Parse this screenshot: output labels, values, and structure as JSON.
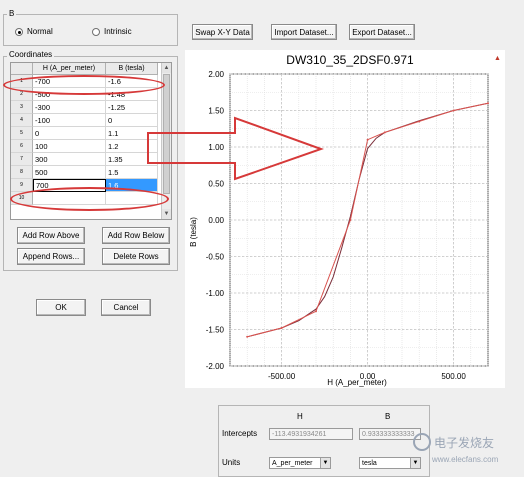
{
  "b_group": {
    "legend": "B",
    "radio_normal": "Normal",
    "radio_intrinsic": "Intrinsic",
    "selected": "Normal"
  },
  "toolbar": {
    "swap_xy": "Swap X-Y Data",
    "import_dataset": "Import Dataset...",
    "export_dataset": "Export Dataset..."
  },
  "coordinates": {
    "legend": "Coordinates",
    "columns": [
      "H (A_per_meter)",
      "B (tesla)"
    ],
    "rows": [
      {
        "n": "1",
        "h": "-700",
        "b": "-1.6"
      },
      {
        "n": "2",
        "h": "-500",
        "b": "-1.48"
      },
      {
        "n": "3",
        "h": "-300",
        "b": "-1.25"
      },
      {
        "n": "4",
        "h": "-100",
        "b": "0"
      },
      {
        "n": "5",
        "h": "0",
        "b": "1.1"
      },
      {
        "n": "6",
        "h": "100",
        "b": "1.2"
      },
      {
        "n": "7",
        "h": "300",
        "b": "1.35"
      },
      {
        "n": "8",
        "h": "500",
        "b": "1.5"
      },
      {
        "n": "9",
        "h": "700",
        "b": "1.6"
      },
      {
        "n": "10",
        "h": "",
        "b": ""
      }
    ]
  },
  "row_buttons": {
    "add_above": "Add Row Above",
    "add_below": "Add Row Below",
    "append": "Append Rows...",
    "delete": "Delete Rows"
  },
  "dialog": {
    "ok": "OK",
    "cancel": "Cancel"
  },
  "chart_data": {
    "type": "line",
    "title": "DW310_35_2DSF0.971",
    "xlabel": "H (A_per_meter)",
    "ylabel": "B (tesla)",
    "xlim": [
      -800,
      700
    ],
    "ylim": [
      -2.0,
      2.0
    ],
    "xticks": [
      -500,
      0,
      500
    ],
    "xtick_labels": [
      "-500.00",
      "0.00",
      "500.00"
    ],
    "yticks": [
      2.0,
      1.5,
      1.0,
      0.5,
      0.0,
      -0.5,
      -1.0,
      -1.5,
      -2.0
    ],
    "ytick_labels": [
      "2.00",
      "1.50",
      "1.00",
      "0.50",
      "0.00",
      "-0.50",
      "-1.00",
      "-1.50",
      "-2.00"
    ],
    "grid": true,
    "series": [
      {
        "x": [
          -700,
          -500,
          -300,
          -100,
          0,
          100,
          300,
          500,
          700
        ],
        "y": [
          -1.6,
          -1.48,
          -1.25,
          0,
          1.1,
          1.2,
          1.35,
          1.5,
          1.6
        ],
        "color": "#d9534f"
      }
    ],
    "fitted": {
      "x": [
        -700,
        -500,
        -400,
        -300,
        -250,
        -200,
        -150,
        -100,
        -50,
        0,
        50,
        100,
        200,
        300,
        500,
        700
      ],
      "y": [
        -1.6,
        -1.48,
        -1.38,
        -1.22,
        -1.05,
        -0.78,
        -0.38,
        0.05,
        0.55,
        0.98,
        1.12,
        1.2,
        1.28,
        1.36,
        1.5,
        1.6
      ],
      "color": "#7b2e3a"
    }
  },
  "intercepts": {
    "col_h": "H",
    "col_b": "B",
    "label": "Intercepts",
    "h_value": "-113.4931934261",
    "b_value": "0.933333333333",
    "units_label": "Units",
    "h_unit": "A_per_meter",
    "b_unit": "tesla"
  },
  "annotation": {
    "arrow_color": "#d63939"
  },
  "watermark": {
    "text": "电子发烧友",
    "url": "www.elecfans.com"
  }
}
